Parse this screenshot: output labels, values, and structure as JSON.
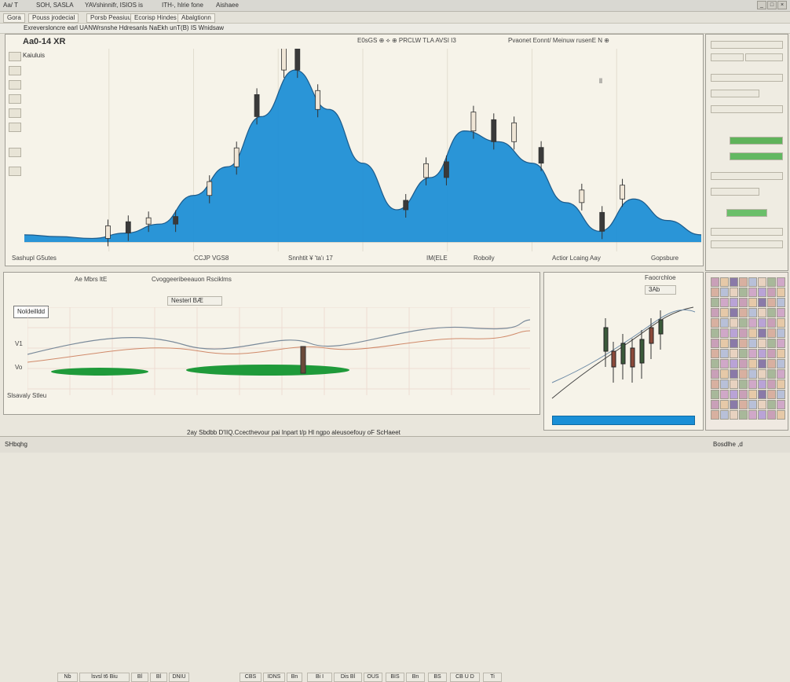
{
  "window": {
    "title_items": [
      "Aa/ T",
      "SOH, SASLA",
      "YAVshinnifr, ISIOS is",
      "ITH-, hlrie fone",
      "Aishaee"
    ],
    "menu_items": [
      "Gora",
      "Pouss jrodecial",
      "Porsb Peasiuurs",
      "Ecorisp Hindes",
      "Abalgtionn"
    ],
    "header_text": "Exreversloncre earl UANWrsnshe Hdresanls NaEkh unT(B) IS Wnidsaw",
    "controls": [
      "_",
      "□",
      "×"
    ]
  },
  "main_chart": {
    "symbol": "Aa0-14 XR",
    "sub": "Kaiuluis",
    "header_center": "E0sGS ⊕ ⟡ ⊕ PRCLW TLA AVSI I3",
    "header_right": "Pvaonet Eonnt/ Meinuw rusenE N ⊕",
    "bottom_labels": [
      "Sashupl G5utes",
      "CCJP VGS8",
      "Snnhtit ¥ 'ta'ı 17",
      "IM(ELE",
      "Roboily",
      "Actior Lcaing Aay",
      "Gopsbure"
    ],
    "marker": "ll",
    "chart_data": {
      "type": "area",
      "series": [
        {
          "values": [
            4,
            3,
            2,
            5,
            10,
            26,
            42,
            70,
            96,
            74,
            44,
            18,
            36,
            62,
            56,
            44,
            22,
            6,
            24,
            12,
            4
          ]
        }
      ],
      "candles": [
        {
          "x": 0.12,
          "h": 0.2,
          "up": true
        },
        {
          "x": 0.15,
          "h": 0.18,
          "up": false
        },
        {
          "x": 0.18,
          "h": 0.1,
          "up": true
        },
        {
          "x": 0.22,
          "h": 0.12,
          "up": false
        },
        {
          "x": 0.27,
          "h": 0.22,
          "up": true
        },
        {
          "x": 0.31,
          "h": 0.3,
          "up": true
        },
        {
          "x": 0.34,
          "h": 0.35,
          "up": false
        },
        {
          "x": 0.38,
          "h": 0.4,
          "up": true
        },
        {
          "x": 0.4,
          "h": 0.38,
          "up": false
        },
        {
          "x": 0.43,
          "h": 0.3,
          "up": true
        },
        {
          "x": 0.56,
          "h": 0.15,
          "up": false
        },
        {
          "x": 0.59,
          "h": 0.22,
          "up": true
        },
        {
          "x": 0.62,
          "h": 0.25,
          "up": false
        },
        {
          "x": 0.66,
          "h": 0.3,
          "up": true
        },
        {
          "x": 0.69,
          "h": 0.35,
          "up": false
        },
        {
          "x": 0.72,
          "h": 0.3,
          "up": true
        },
        {
          "x": 0.76,
          "h": 0.25,
          "up": false
        },
        {
          "x": 0.82,
          "h": 0.2,
          "up": true
        },
        {
          "x": 0.85,
          "h": 0.3,
          "up": false
        },
        {
          "x": 0.88,
          "h": 0.22,
          "up": true
        }
      ],
      "colors": {
        "area": "#1f8fd6",
        "line": "#1c5a8a",
        "candle_up": "#f0e6d6",
        "candle_down": "#3a3a3a"
      }
    }
  },
  "lower_left_chart": {
    "title": "Ae Mbrs ltE",
    "subtitle": "Cvoggeeribeeauon Rsciklms",
    "button": "Nesterl BÆ",
    "legend": "Noldeilldd",
    "ylabels": [
      "V1",
      "V1",
      "Vo"
    ],
    "xlabel": "Slsavaly Stleu",
    "status_cells": [
      "Nb",
      "lsvsl t6 Biu",
      "Bl",
      "Bl",
      "DNIU",
      "CBS",
      "IDNS",
      "Bn",
      "Bi I",
      "Dis Bl",
      "OUS",
      "BIS",
      "Bn",
      "BS",
      "CB U D",
      "Ti"
    ]
  },
  "lower_right_chart": {
    "title": "Faocrchloe",
    "button": "3Ab"
  },
  "footer": {
    "left": "SHbqhg",
    "center": "2ay Sbdbb D'IIQ.Ccecthevour pai Inpart t/p Hl ngpo aleusoefouy oF ScHaeet",
    "right": "Bosdlhe ,d"
  }
}
